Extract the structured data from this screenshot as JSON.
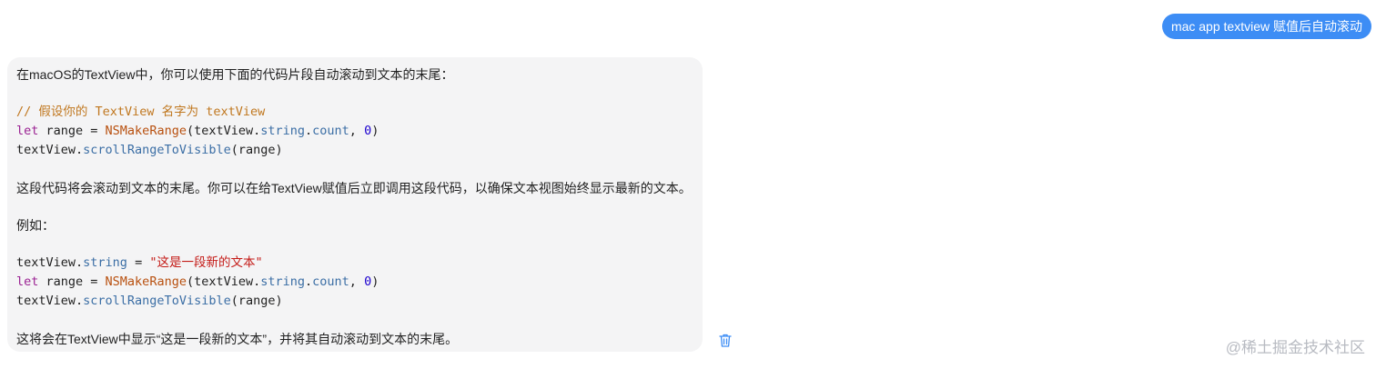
{
  "user_message": {
    "text": "mac app textview 赋值后自动滚动"
  },
  "assistant_message": {
    "intro": "在macOS的TextView中，你可以使用下面的代码片段自动滚动到文本的末尾：",
    "code1": {
      "comment": "// 假设你的 TextView 名字为 textView",
      "line2_kw": "let",
      "line2_a": " range = ",
      "line2_fn": "NSMakeRange",
      "line2_b": "(textView.",
      "line2_prop": "string",
      "line2_c": ".",
      "line2_prop2": "count",
      "line2_d": ", ",
      "line2_num": "0",
      "line2_e": ")",
      "line3_a": "textView.",
      "line3_fn": "scrollRangeToVisible",
      "line3_b": "(range)"
    },
    "explain": "这段代码将会滚动到文本的末尾。你可以在给TextView赋值后立即调用这段代码，以确保文本视图始终显示最新的文本。",
    "example_label": "例如：",
    "code2": {
      "line1_a": "textView.",
      "line1_prop": "string",
      "line1_b": " = ",
      "line1_str": "\"这是一段新的文本\"",
      "line2_kw": "let",
      "line2_a": " range = ",
      "line2_fn": "NSMakeRange",
      "line2_b": "(textView.",
      "line2_prop": "string",
      "line2_c": ".",
      "line2_prop2": "count",
      "line2_d": ", ",
      "line2_num": "0",
      "line2_e": ")",
      "line3_a": "textView.",
      "line3_fn": "scrollRangeToVisible",
      "line3_b": "(range)"
    },
    "outro": "这将会在TextView中显示“这是一段新的文本”，并将其自动滚动到文本的末尾。"
  },
  "icons": {
    "delete": "trash-icon"
  },
  "watermark": "@稀土掘金技术社区",
  "colors": {
    "user_bubble": "#3d8df5",
    "assistant_bubble": "#f4f4f5",
    "comment": "#c0771f",
    "keyword": "#9b2393",
    "function": "#b8500f",
    "property": "#3b6ea5",
    "number": "#1c00cf",
    "string": "#c41a16",
    "trash_icon": "#3d8df5"
  }
}
